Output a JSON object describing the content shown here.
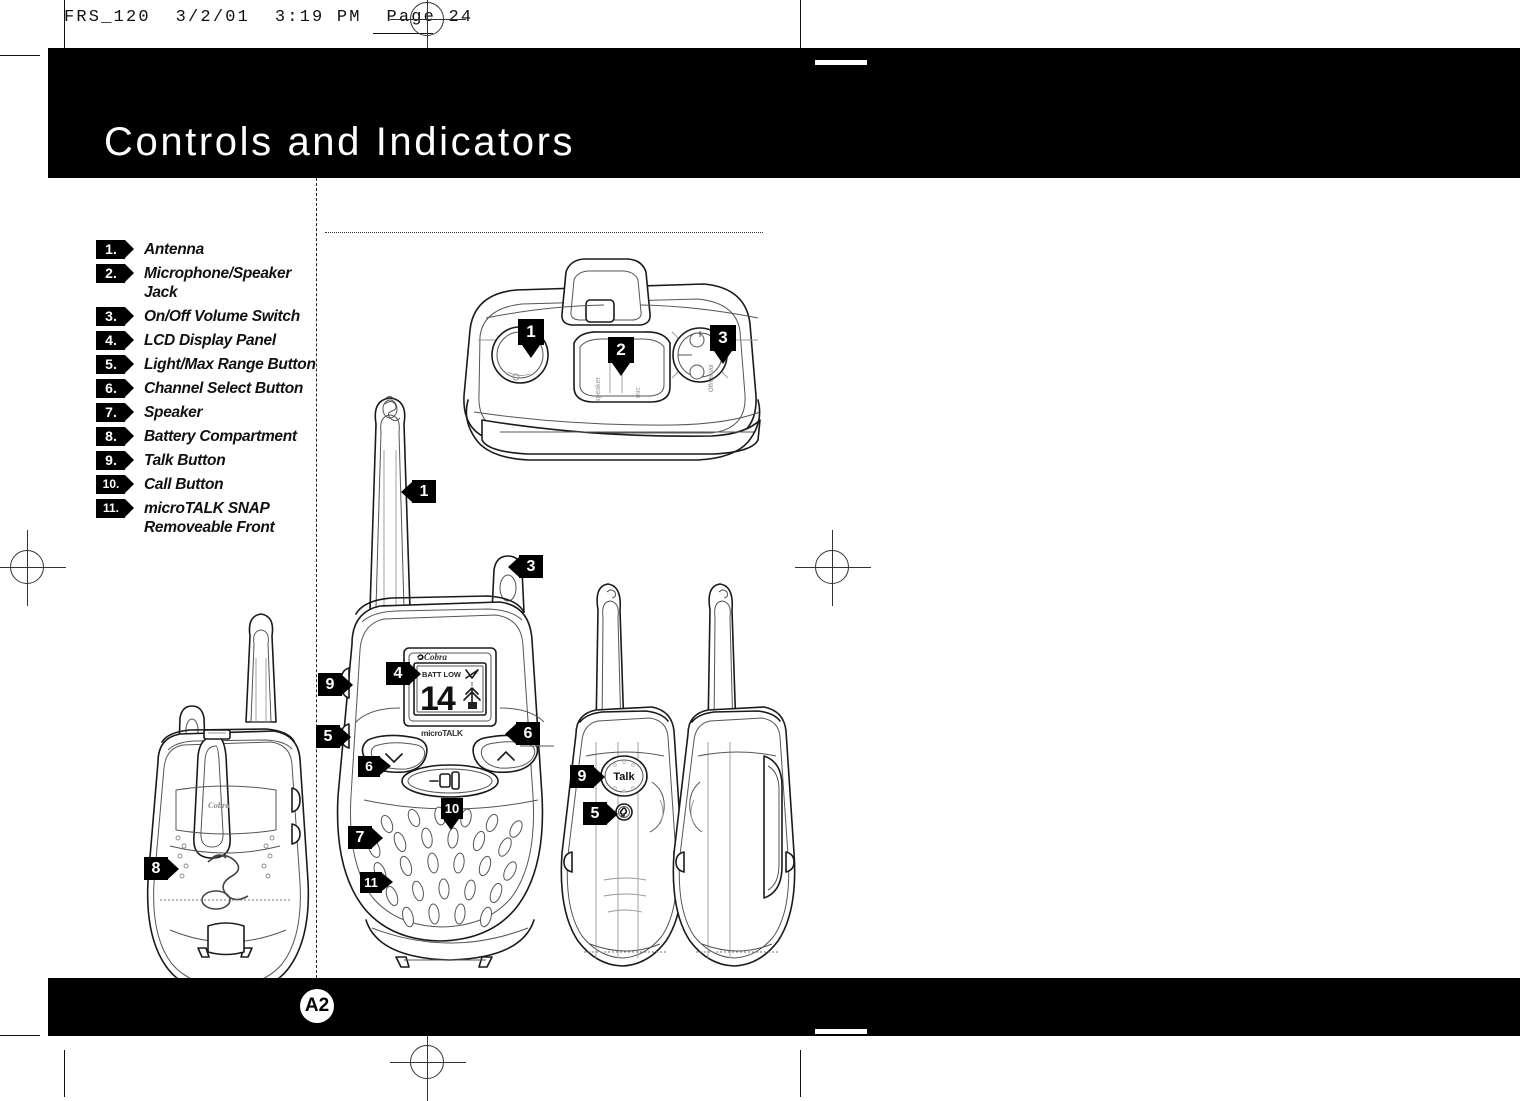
{
  "prepress": {
    "header_text": "FRS_120  3/2/01  3:19 PM  Page 24",
    "page_marker": "A2"
  },
  "header": {
    "title": "Controls and Indicators"
  },
  "legend": {
    "items": [
      {
        "num": "1.",
        "label": "Antenna"
      },
      {
        "num": "2.",
        "label": "Microphone/Speaker Jack"
      },
      {
        "num": "3.",
        "label": "On/Off Volume Switch"
      },
      {
        "num": "4.",
        "label": "LCD Display Panel"
      },
      {
        "num": "5.",
        "label": "Light/Max Range Button"
      },
      {
        "num": "6.",
        "label": "Channel Select Button"
      },
      {
        "num": "7.",
        "label": "Speaker"
      },
      {
        "num": "8.",
        "label": "Battery Compartment"
      },
      {
        "num": "9.",
        "label": "Talk Button"
      },
      {
        "num": "10.",
        "label": "Call Button"
      },
      {
        "num": "11.",
        "label": "microTALK SNAP Removeable Front"
      }
    ]
  },
  "figures": {
    "top_view": {
      "callouts": [
        {
          "id": "1",
          "num": "1"
        },
        {
          "id": "2",
          "num": "2"
        },
        {
          "id": "3",
          "num": "3"
        }
      ],
      "port_labels": [
        "speaker",
        "mic"
      ],
      "switch_label": "Off/On Vol"
    },
    "front_view": {
      "brand": "Cobra",
      "sub_brand": "microTALK",
      "lcd": {
        "battery_text": "BATT LOW",
        "channel": "14"
      },
      "callouts": [
        {
          "id": "1",
          "num": "1"
        },
        {
          "id": "3",
          "num": "3"
        },
        {
          "id": "4",
          "num": "4"
        },
        {
          "id": "5",
          "num": "5"
        },
        {
          "id": "6a",
          "num": "6"
        },
        {
          "id": "6b",
          "num": "6"
        },
        {
          "id": "7",
          "num": "7"
        },
        {
          "id": "9",
          "num": "9"
        },
        {
          "id": "10",
          "num": "10"
        },
        {
          "id": "11",
          "num": "11"
        }
      ]
    },
    "rear_view": {
      "brand": "Cobra",
      "callouts": [
        {
          "id": "8",
          "num": "8"
        }
      ]
    },
    "side_views": {
      "talk_label": "Talk",
      "callouts": [
        {
          "id": "9",
          "num": "9"
        },
        {
          "id": "5",
          "num": "5"
        }
      ]
    }
  },
  "colors": {
    "bar": "#000000",
    "page_bg": "#ffffff",
    "line": "#111111"
  }
}
